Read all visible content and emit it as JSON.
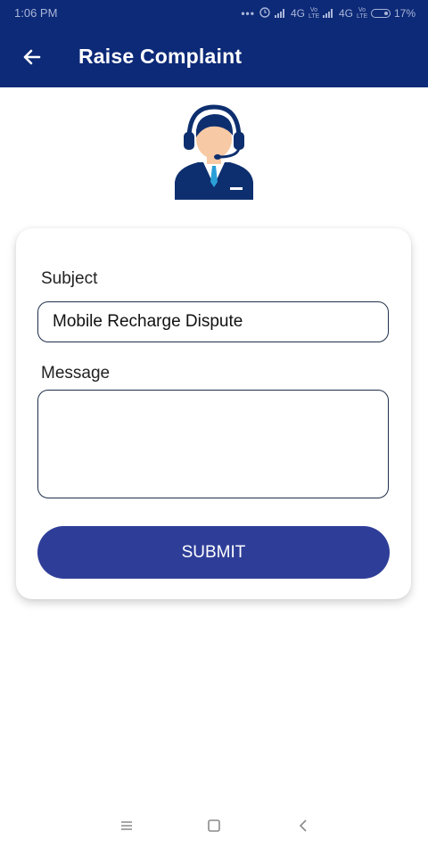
{
  "status_bar": {
    "time": "1:06 PM",
    "network_1": "4G",
    "network_2": "4G",
    "volte_label": "Vo LTE",
    "battery": "17%"
  },
  "header": {
    "title": "Raise Complaint",
    "back_icon": "arrow-left-icon"
  },
  "illustration": {
    "icon": "support-agent-icon"
  },
  "form": {
    "subject_label": "Subject",
    "subject_value": "Mobile Recharge Dispute",
    "message_label": "Message",
    "message_value": "",
    "submit_label": "SUBMIT"
  },
  "nav_bar": {
    "icons": [
      "menu-icon",
      "home-icon",
      "back-icon"
    ]
  },
  "colors": {
    "primary": "#0d2a78",
    "button": "#2e3e98",
    "input_border": "#1f2f4a"
  }
}
